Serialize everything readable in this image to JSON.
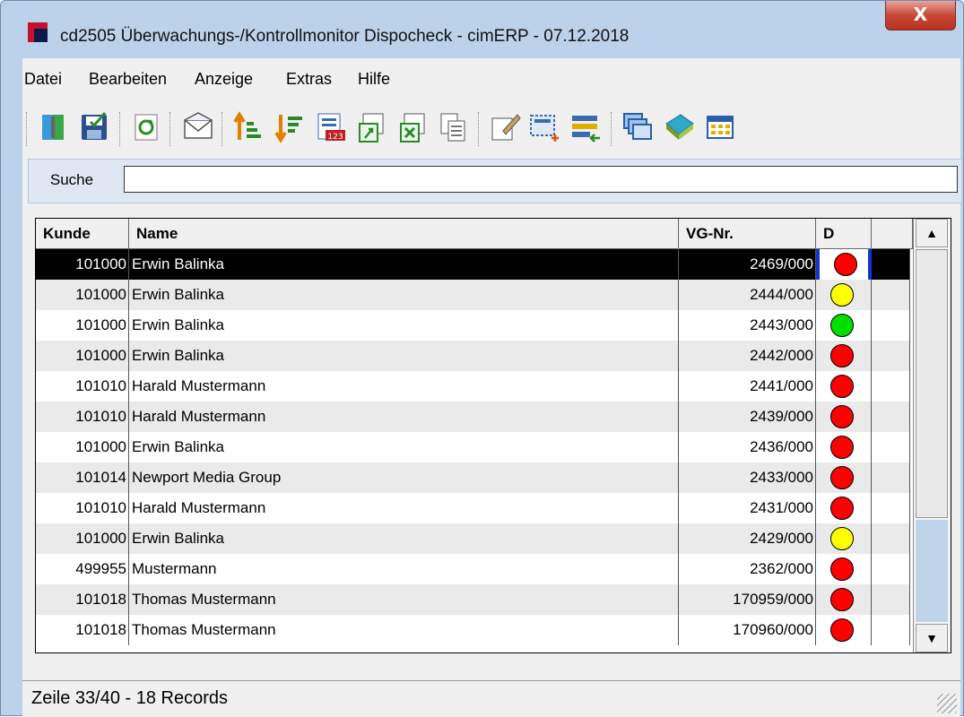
{
  "window": {
    "title": "cd2505 Überwachungs-/Kontrollmonitor Dispocheck - cimERP - 07.12.2018",
    "close_label": "X"
  },
  "menu": [
    "Datei",
    "Bearbeiten",
    "Anzeige",
    "Extras",
    "Hilfe"
  ],
  "toolbar": [
    "exit-icon",
    "save-icon",
    "refresh-icon",
    "envelope-icon",
    "sort-ascending-icon",
    "sort-descending-icon",
    "numbering-icon",
    "export-icon",
    "excel-icon",
    "copy-icon",
    "edit-icon",
    "new-selection-icon",
    "transfer-icon",
    "windows-icon",
    "book-icon",
    "grid-icon"
  ],
  "search": {
    "label": "Suche",
    "value": ""
  },
  "table": {
    "headers": {
      "kunde": "Kunde",
      "name": "Name",
      "vg": "VG-Nr.",
      "d": "D"
    },
    "rows": [
      {
        "kunde": "101000",
        "name": "Erwin Balinka",
        "vg": "2469/000",
        "status": "red",
        "selected": true
      },
      {
        "kunde": "101000",
        "name": "Erwin Balinka",
        "vg": "2444/000",
        "status": "yellow"
      },
      {
        "kunde": "101000",
        "name": "Erwin Balinka",
        "vg": "2443/000",
        "status": "green"
      },
      {
        "kunde": "101000",
        "name": "Erwin Balinka",
        "vg": "2442/000",
        "status": "red"
      },
      {
        "kunde": "101010",
        "name": "Harald  Mustermann",
        "vg": "2441/000",
        "status": "red"
      },
      {
        "kunde": "101010",
        "name": "Harald  Mustermann",
        "vg": "2439/000",
        "status": "red"
      },
      {
        "kunde": "101000",
        "name": "Erwin Balinka",
        "vg": "2436/000",
        "status": "red"
      },
      {
        "kunde": "101014",
        "name": "Newport Media Group",
        "vg": "2433/000",
        "status": "red"
      },
      {
        "kunde": "101010",
        "name": "Harald  Mustermann",
        "vg": "2431/000",
        "status": "red"
      },
      {
        "kunde": "101000",
        "name": "Erwin Balinka",
        "vg": "2429/000",
        "status": "yellow"
      },
      {
        "kunde": "499955",
        "name": "Mustermann",
        "vg": "2362/000",
        "status": "red"
      },
      {
        "kunde": "101018",
        "name": "Thomas Mustermann",
        "vg": "170959/000",
        "status": "red"
      },
      {
        "kunde": "101018",
        "name": "Thomas Mustermann",
        "vg": "170960/000",
        "status": "red"
      }
    ]
  },
  "status_colors": {
    "red": "#ff0000",
    "yellow": "#ffff00",
    "green": "#00e000"
  },
  "statusbar": {
    "text": "Zeile 33/40 - 18 Records"
  }
}
